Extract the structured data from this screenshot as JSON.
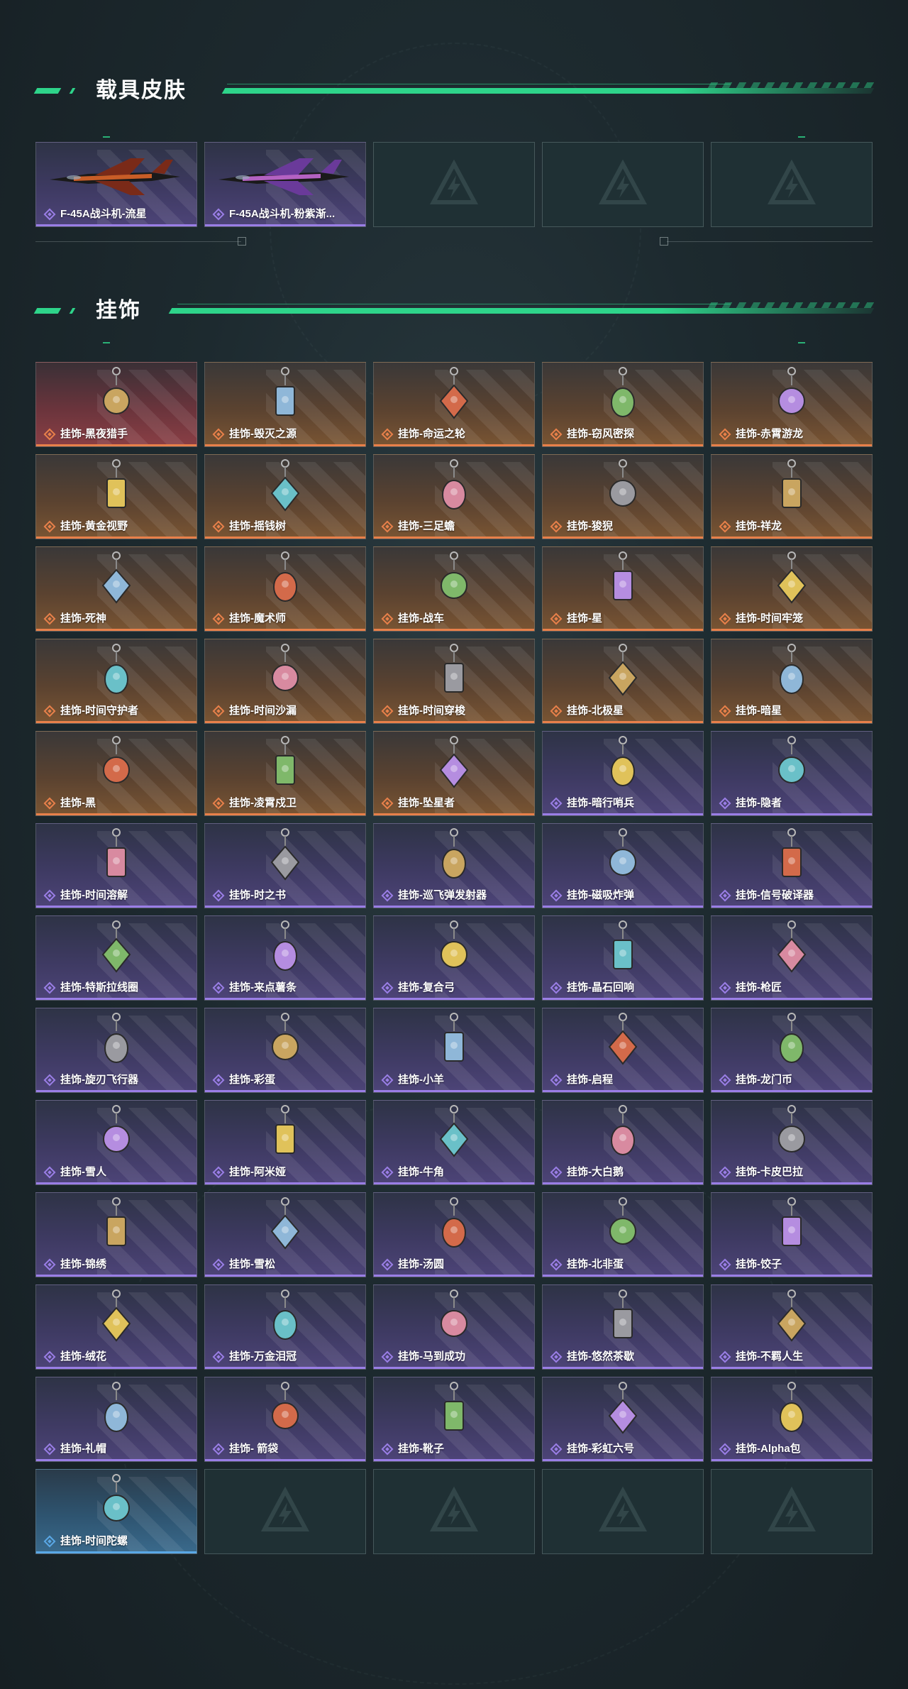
{
  "sections": {
    "vehicle": {
      "title": "载具皮肤"
    },
    "charms": {
      "title": "挂饰"
    }
  },
  "colors": {
    "accent": "#2ed48a",
    "orange_tier": "#e8804a",
    "purple_tier": "#9a7ee6",
    "blue_tier": "#5aa8e6",
    "red_tier": "#8a3f45"
  },
  "vehicle_items": [
    {
      "name": "F-45A战斗机-流星",
      "tier": "purple",
      "art": "jet-flame"
    },
    {
      "name": "F-45A战斗机-粉紫渐...",
      "tier": "purple",
      "art": "jet-purple"
    },
    {
      "name": "",
      "tier": "empty"
    },
    {
      "name": "",
      "tier": "empty"
    },
    {
      "name": "",
      "tier": "empty"
    }
  ],
  "charm_items": [
    {
      "name": "挂饰-黑夜猎手",
      "tier": "red",
      "icon": "charm-icon"
    },
    {
      "name": "挂饰-毁灭之源",
      "tier": "orange",
      "icon": "charm-icon"
    },
    {
      "name": "挂饰-命运之轮",
      "tier": "orange",
      "icon": "charm-icon"
    },
    {
      "name": "挂饰-窃风密探",
      "tier": "orange",
      "icon": "charm-icon"
    },
    {
      "name": "挂饰-赤霄游龙",
      "tier": "orange",
      "icon": "charm-icon"
    },
    {
      "name": "挂饰-黄金视野",
      "tier": "orange",
      "icon": "charm-icon"
    },
    {
      "name": "挂饰-摇钱树",
      "tier": "orange",
      "icon": "charm-icon"
    },
    {
      "name": "挂饰-三足蟾",
      "tier": "orange",
      "icon": "charm-icon"
    },
    {
      "name": "挂饰-狻猊",
      "tier": "orange",
      "icon": "charm-icon"
    },
    {
      "name": "挂饰-祥龙",
      "tier": "orange",
      "icon": "charm-icon"
    },
    {
      "name": "挂饰-死神",
      "tier": "orange",
      "icon": "charm-icon"
    },
    {
      "name": "挂饰-魔术师",
      "tier": "orange",
      "icon": "charm-icon"
    },
    {
      "name": "挂饰-战车",
      "tier": "orange",
      "icon": "charm-icon"
    },
    {
      "name": "挂饰-星",
      "tier": "orange",
      "icon": "charm-icon"
    },
    {
      "name": "挂饰-时间牢笼",
      "tier": "orange",
      "icon": "charm-icon"
    },
    {
      "name": "挂饰-时间守护者",
      "tier": "orange",
      "icon": "charm-icon"
    },
    {
      "name": "挂饰-时间沙漏",
      "tier": "orange",
      "icon": "charm-icon"
    },
    {
      "name": "挂饰-时间穿梭",
      "tier": "orange",
      "icon": "charm-icon"
    },
    {
      "name": "挂饰-北极星",
      "tier": "orange",
      "icon": "charm-icon"
    },
    {
      "name": "挂饰-暗星",
      "tier": "orange",
      "icon": "charm-icon"
    },
    {
      "name": "挂饰-黑",
      "tier": "orange",
      "icon": "charm-icon"
    },
    {
      "name": "挂饰-凌霄戍卫",
      "tier": "orange",
      "icon": "charm-icon"
    },
    {
      "name": "挂饰-坠星者",
      "tier": "orange",
      "icon": "charm-icon"
    },
    {
      "name": "挂饰-暗行哨兵",
      "tier": "purple",
      "icon": "charm-icon"
    },
    {
      "name": "挂饰-隐者",
      "tier": "purple",
      "icon": "charm-icon"
    },
    {
      "name": "挂饰-时间溶解",
      "tier": "purple",
      "icon": "charm-icon"
    },
    {
      "name": "挂饰-时之书",
      "tier": "purple",
      "icon": "charm-icon"
    },
    {
      "name": "挂饰-巡飞弹发射器",
      "tier": "purple",
      "icon": "charm-icon"
    },
    {
      "name": "挂饰-磁吸炸弹",
      "tier": "purple",
      "icon": "charm-icon"
    },
    {
      "name": "挂饰-信号破译器",
      "tier": "purple",
      "icon": "charm-icon"
    },
    {
      "name": "挂饰-特斯拉线圈",
      "tier": "purple",
      "icon": "charm-icon"
    },
    {
      "name": "挂饰-来点薯条",
      "tier": "purple",
      "icon": "charm-icon"
    },
    {
      "name": "挂饰-复合弓",
      "tier": "purple",
      "icon": "charm-icon"
    },
    {
      "name": "挂饰-晶石回响",
      "tier": "purple",
      "icon": "charm-icon"
    },
    {
      "name": "挂饰-枪匠",
      "tier": "purple",
      "icon": "charm-icon"
    },
    {
      "name": "挂饰-旋刃飞行器",
      "tier": "purple",
      "icon": "charm-icon"
    },
    {
      "name": "挂饰-彩蛋",
      "tier": "purple",
      "icon": "charm-icon"
    },
    {
      "name": "挂饰-小羊",
      "tier": "purple",
      "icon": "charm-icon"
    },
    {
      "name": "挂饰-启程",
      "tier": "purple",
      "icon": "charm-icon"
    },
    {
      "name": "挂饰-龙门币",
      "tier": "purple",
      "icon": "charm-icon"
    },
    {
      "name": "挂饰-雪人",
      "tier": "purple",
      "icon": "charm-icon"
    },
    {
      "name": "挂饰-阿米娅",
      "tier": "purple",
      "icon": "charm-icon"
    },
    {
      "name": "挂饰-牛角",
      "tier": "purple",
      "icon": "charm-icon"
    },
    {
      "name": "挂饰-大白鹅",
      "tier": "purple",
      "icon": "charm-icon"
    },
    {
      "name": "挂饰-卡皮巴拉",
      "tier": "purple",
      "icon": "charm-icon"
    },
    {
      "name": "挂饰-锦绣",
      "tier": "purple",
      "icon": "charm-icon"
    },
    {
      "name": "挂饰-雪松",
      "tier": "purple",
      "icon": "charm-icon"
    },
    {
      "name": "挂饰-汤圆",
      "tier": "purple",
      "icon": "charm-icon"
    },
    {
      "name": "挂饰-北非蛋",
      "tier": "purple",
      "icon": "charm-icon"
    },
    {
      "name": "挂饰-饺子",
      "tier": "purple",
      "icon": "charm-icon"
    },
    {
      "name": "挂饰-绒花",
      "tier": "purple",
      "icon": "charm-icon"
    },
    {
      "name": "挂饰-万金泪冠",
      "tier": "purple",
      "icon": "charm-icon"
    },
    {
      "name": "挂饰-马到成功",
      "tier": "purple",
      "icon": "charm-icon"
    },
    {
      "name": "挂饰-悠然茶歇",
      "tier": "purple",
      "icon": "charm-icon"
    },
    {
      "name": "挂饰-不羁人生",
      "tier": "purple",
      "icon": "charm-icon"
    },
    {
      "name": "挂饰-礼帽",
      "tier": "purple",
      "icon": "charm-icon"
    },
    {
      "name": "挂饰- 箭袋",
      "tier": "purple",
      "icon": "charm-icon"
    },
    {
      "name": "挂饰-靴子",
      "tier": "purple",
      "icon": "charm-icon"
    },
    {
      "name": "挂饰-彩虹六号",
      "tier": "purple",
      "icon": "charm-icon"
    },
    {
      "name": "挂饰-Alpha包",
      "tier": "purple",
      "icon": "charm-icon"
    },
    {
      "name": "挂饰-时间陀螺",
      "tier": "blue",
      "icon": "charm-icon"
    },
    {
      "name": "",
      "tier": "empty"
    },
    {
      "name": "",
      "tier": "empty"
    },
    {
      "name": "",
      "tier": "empty"
    },
    {
      "name": "",
      "tier": "empty"
    }
  ]
}
